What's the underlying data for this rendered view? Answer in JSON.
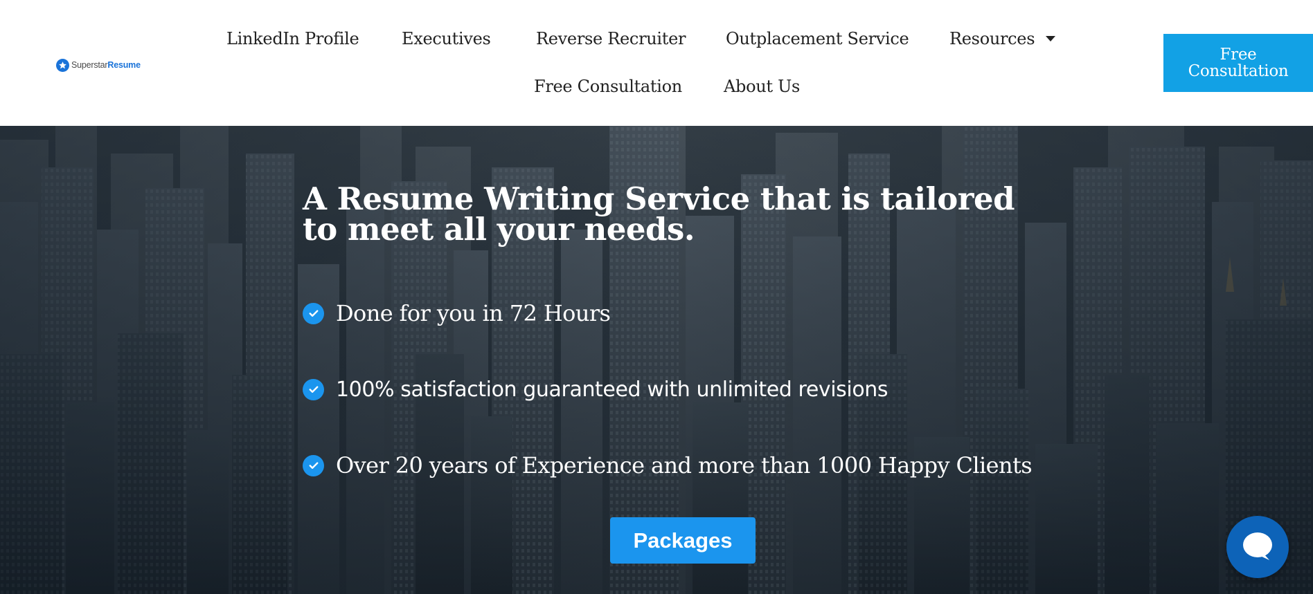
{
  "brand": {
    "logo_prefix": "Superstar",
    "logo_suffix": "Resume",
    "accent_color": "#1a73d9"
  },
  "nav": {
    "items": [
      {
        "label": "LinkedIn Profile"
      },
      {
        "label": "Executives"
      },
      {
        "label": "Reverse Recruiter"
      },
      {
        "label": "Outplacement Service"
      },
      {
        "label": "Resources",
        "has_dropdown": true,
        "icon": "chevron-down-icon"
      },
      {
        "label": "Free Consultation"
      },
      {
        "label": "About Us"
      }
    ],
    "cta_line1": "Free",
    "cta_line2": "Consultation",
    "cta_color": "#12a1e5"
  },
  "hero": {
    "title": "A Resume Writing Service that is tailored to meet all your needs.",
    "features": [
      {
        "text": "Done for you in 72 Hours",
        "icon": "check-circle-icon"
      },
      {
        "text": "100% satisfaction guaranteed with unlimited revisions",
        "icon": "check-circle-icon"
      },
      {
        "text": "Over 20 years of Experience and more than 1000 Happy Clients",
        "icon": "check-circle-icon"
      }
    ],
    "packages_label": "Packages",
    "button_color": "#1b95ee",
    "background": "city-skyline-photo"
  },
  "chat": {
    "icon": "chat-bubble-icon",
    "color": "#0d63b8"
  }
}
